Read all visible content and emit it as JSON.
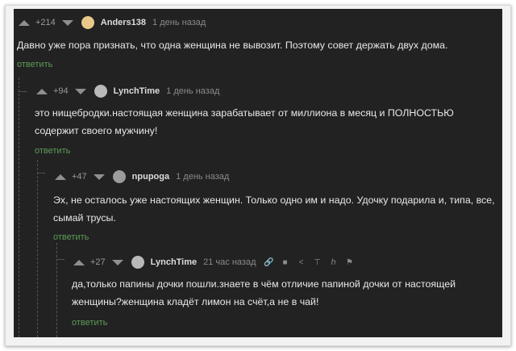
{
  "comments": [
    {
      "rating": "+214",
      "author": "Anders138",
      "time": "1 день назад",
      "text": "Давно уже пора признать, что одна женщина не вывозит. Поэтому совет держать двух дома.",
      "reply": "ответить",
      "avatar_color": "#e8c98a"
    },
    {
      "rating": "+94",
      "author": "LynchTime",
      "time": "1 день назад",
      "text": "это нищебродки.настоящая женщина зарабатывает от миллиона в месяц и ПОЛНОСТЬЮ содержит своего мужчину!",
      "reply": "ответить",
      "avatar_color": "#b9b9b9"
    },
    {
      "rating": "+47",
      "author": "npupoga",
      "time": "1 день назад",
      "text": "Эх, не осталось уже настоящих женщин. Только одно им и надо. Удочку подарила и, типа, все, сымай трусы.",
      "reply": "ответить",
      "avatar_color": "#9c9c9c"
    },
    {
      "rating": "+27",
      "author": "LynchTime",
      "time": "21 час назад",
      "text": "да,только папины дочки пошли.знаете в чём отличие папиной дочки от настоящей женщины?женщина кладёт лимон на счёт,а не в чай!",
      "reply": "ответить",
      "avatar_color": "#b9b9b9",
      "tools": [
        "link-icon",
        "save-icon",
        "share-icon",
        "pin-icon",
        "flag-small-icon",
        "report-icon"
      ]
    }
  ]
}
